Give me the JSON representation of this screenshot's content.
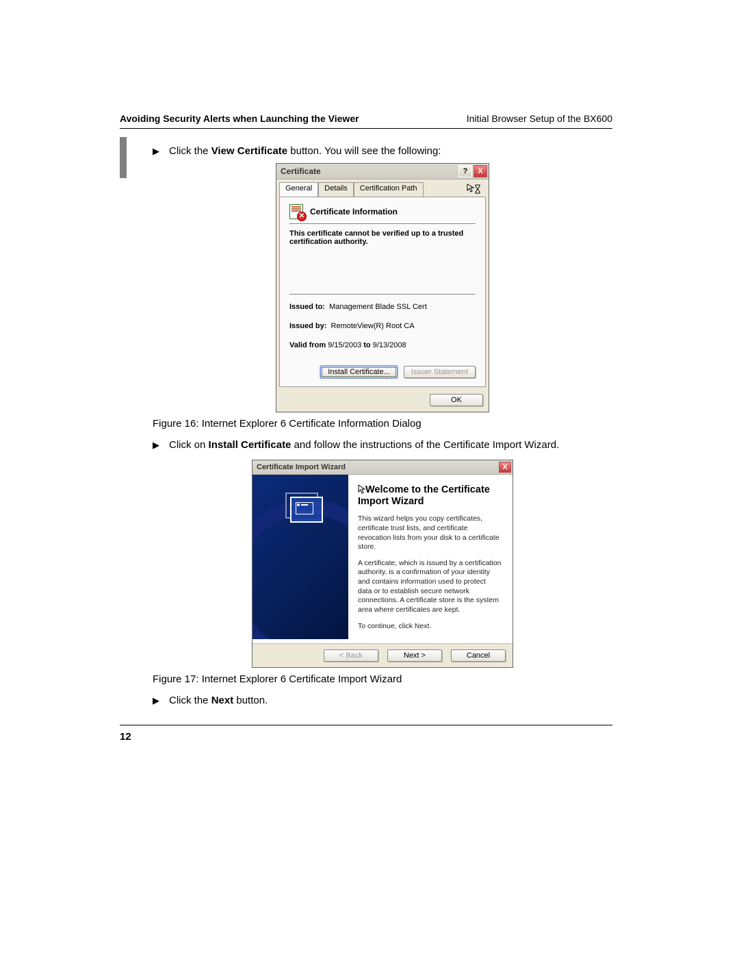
{
  "header": {
    "left": "Avoiding Security Alerts when Launching the Viewer",
    "right": "Initial Browser Setup of the BX600"
  },
  "bullets": {
    "b1_pre": "Click the ",
    "b1_bold": "View Certificate",
    "b1_post": " button. You will see the following:",
    "b2_pre": "Click on ",
    "b2_bold": "Install Certificate",
    "b2_post": " and follow the instructions of the Certificate Import Wizard.",
    "b3_pre": "Click the ",
    "b3_bold": "Next",
    "b3_post": " button."
  },
  "cert": {
    "title": "Certificate",
    "help": "?",
    "close": "X",
    "tabs": {
      "general": "General",
      "details": "Details",
      "path": "Certification Path"
    },
    "info_title": "Certificate Information",
    "warn": "This certificate cannot be verified up to a trusted certification authority.",
    "issued_to_label": "Issued to:",
    "issued_to_value": "Management Blade SSL Cert",
    "issued_by_label": "Issued by:",
    "issued_by_value": "RemoteView(R) Root CA",
    "valid_label": "Valid from",
    "valid_from": "9/15/2003",
    "valid_to_label": "to",
    "valid_to": "9/13/2008",
    "install_btn": "Install Certificate...",
    "issuer_btn": "Issuer Statement",
    "ok_btn": "OK"
  },
  "fig16": "Figure 16: Internet Explorer 6 Certificate Information Dialog",
  "wiz": {
    "title": "Certificate Import Wizard",
    "close": "X",
    "heading": "Welcome to the Certificate Import Wizard",
    "p1": "This wizard helps you copy certificates, certificate trust lists, and certificate revocation lists from your disk to a certificate store.",
    "p2": "A certificate, which is issued by a certification authority, is a confirmation of your identity and contains information used to protect data or to establish secure network connections. A certificate store is the system area where certificates are kept.",
    "p3": "To continue, click Next.",
    "back": "< Back",
    "next": "Next >",
    "cancel": "Cancel"
  },
  "fig17": "Figure 17: Internet Explorer 6 Certificate Import Wizard",
  "page_number": "12"
}
